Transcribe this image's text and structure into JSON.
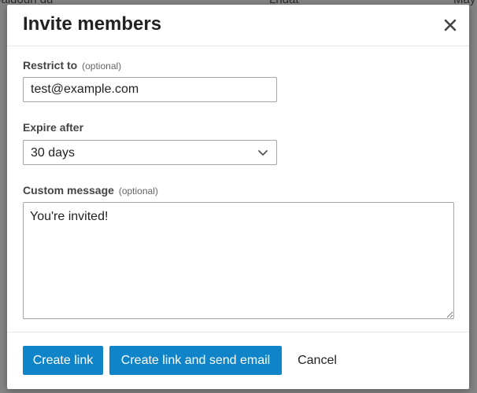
{
  "background": {
    "row_cells": [
      "Jaldoun du",
      "Lndat",
      "May"
    ]
  },
  "dialog": {
    "title": "Invite members",
    "close_icon": "close-icon"
  },
  "form": {
    "restrict": {
      "label": "Restrict to",
      "optional": "(optional)",
      "value": "test@example.com"
    },
    "expire": {
      "label": "Expire after",
      "selected": "30 days",
      "icon": "chevron-down-icon"
    },
    "message": {
      "label": "Custom message",
      "optional": "(optional)",
      "value": "You're invited!"
    }
  },
  "footer": {
    "create_label": "Create link",
    "send_label": "Create link and send email",
    "cancel_label": "Cancel"
  },
  "colors": {
    "primary": "#0f84c8",
    "overlay": "#858585"
  }
}
